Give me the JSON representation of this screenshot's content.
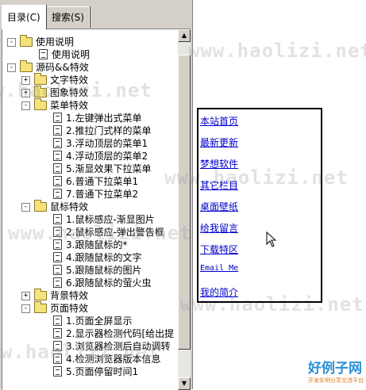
{
  "tabs": [
    {
      "label": "目录(C)",
      "active": true
    },
    {
      "label": "搜索(S)",
      "active": false
    }
  ],
  "tree": [
    {
      "level": 0,
      "expander": "-",
      "icon": "folder",
      "label": "使用说明"
    },
    {
      "level": 1,
      "expander": "",
      "icon": "doc",
      "label": "使用说明"
    },
    {
      "level": 0,
      "expander": "-",
      "icon": "folder",
      "label": "源码&&特效"
    },
    {
      "level": 1,
      "expander": "+",
      "icon": "folder",
      "label": "文字特效"
    },
    {
      "level": 1,
      "expander": "+",
      "icon": "folder",
      "label": "图象特效"
    },
    {
      "level": 1,
      "expander": "-",
      "icon": "folder",
      "label": "菜单特效"
    },
    {
      "level": 2,
      "expander": "",
      "icon": "doc",
      "label": "1.左键弹出式菜单"
    },
    {
      "level": 2,
      "expander": "",
      "icon": "doc",
      "label": "2.推拉门式样的菜单"
    },
    {
      "level": 2,
      "expander": "",
      "icon": "doc",
      "label": "3.浮动顶层的菜单1"
    },
    {
      "level": 2,
      "expander": "",
      "icon": "doc",
      "label": "4.浮动顶层的菜单2"
    },
    {
      "level": 2,
      "expander": "",
      "icon": "doc",
      "label": "5.渐显效果下拉菜单"
    },
    {
      "level": 2,
      "expander": "",
      "icon": "doc",
      "label": "6.普通下拉菜单1"
    },
    {
      "level": 2,
      "expander": "",
      "icon": "doc",
      "label": "7.普通下拉菜单2"
    },
    {
      "level": 1,
      "expander": "-",
      "icon": "folder",
      "label": "鼠标特效"
    },
    {
      "level": 2,
      "expander": "",
      "icon": "doc",
      "label": "1.鼠标感应-渐显图片"
    },
    {
      "level": 2,
      "expander": "",
      "icon": "doc",
      "label": "2.鼠标感应-弹出警告框"
    },
    {
      "level": 2,
      "expander": "",
      "icon": "doc",
      "label": "3.跟随鼠标的*"
    },
    {
      "level": 2,
      "expander": "",
      "icon": "doc",
      "label": "4.跟随鼠标的文字"
    },
    {
      "level": 2,
      "expander": "",
      "icon": "doc",
      "label": "5.跟随鼠标的图片"
    },
    {
      "level": 2,
      "expander": "",
      "icon": "doc",
      "label": "6.跟随鼠标的萤火虫"
    },
    {
      "level": 1,
      "expander": "+",
      "icon": "folder",
      "label": "背景特效"
    },
    {
      "level": 1,
      "expander": "-",
      "icon": "folder",
      "label": "页面特效"
    },
    {
      "level": 2,
      "expander": "",
      "icon": "doc",
      "label": "1.页面全屏显示"
    },
    {
      "level": 2,
      "expander": "",
      "icon": "doc",
      "label": "2.显示器检测代码[给出提"
    },
    {
      "level": 2,
      "expander": "",
      "icon": "doc",
      "label": "3.浏览器检测后自动调转"
    },
    {
      "level": 2,
      "expander": "",
      "icon": "doc",
      "label": "4.检测浏览器版本信息"
    },
    {
      "level": 2,
      "expander": "",
      "icon": "doc",
      "label": "5.页面停留时间1"
    }
  ],
  "nav_links": [
    {
      "label": "本站首页",
      "mono": false
    },
    {
      "label": "最新更新",
      "mono": false
    },
    {
      "label": "梦想软件",
      "mono": false
    },
    {
      "label": "其它栏目",
      "mono": false
    },
    {
      "label": "桌面壁纸",
      "mono": false
    },
    {
      "label": "给我留言",
      "mono": false
    },
    {
      "label": "下载特区",
      "mono": false
    },
    {
      "label": "Email Me",
      "mono": true
    },
    {
      "label": "我的简介",
      "mono": false
    }
  ],
  "watermark": "www.haolizi.net",
  "logo": {
    "title": "好例子网",
    "subtitle": "开发实例分享交流平台"
  }
}
